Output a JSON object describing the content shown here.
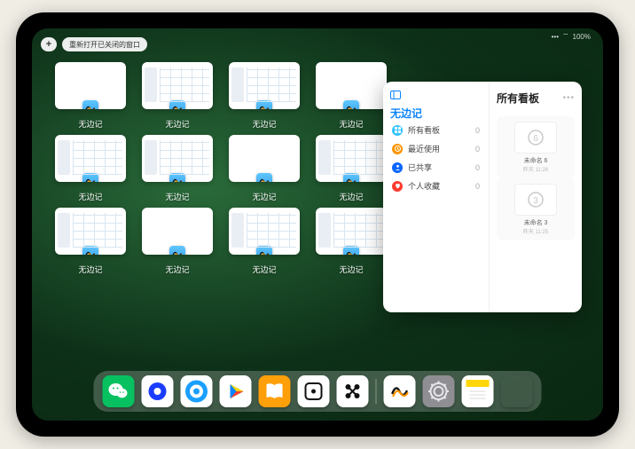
{
  "status": {
    "signal": "•••",
    "wifi": "⌔",
    "battery": "100%"
  },
  "top": {
    "add": "+",
    "reopen": "重新打开已关闭的窗口"
  },
  "app_label": "无边记",
  "windows": [
    {
      "type": "blank"
    },
    {
      "type": "calendar"
    },
    {
      "type": "calendar"
    },
    {
      "type": "blank"
    },
    {
      "type": "calendar"
    },
    {
      "type": "calendar"
    },
    {
      "type": "blank"
    },
    {
      "type": "calendar"
    },
    {
      "type": "calendar"
    },
    {
      "type": "blank"
    },
    {
      "type": "calendar"
    },
    {
      "type": "calendar"
    }
  ],
  "popover": {
    "left_title": "无边记",
    "right_title": "所有看板",
    "items": [
      {
        "icon": "grid",
        "color": "#34c3ff",
        "label": "所有看板",
        "count": 0
      },
      {
        "icon": "clock",
        "color": "#ff9500",
        "label": "最近使用",
        "count": 0
      },
      {
        "icon": "people",
        "color": "#0a66ff",
        "label": "已共享",
        "count": 0
      },
      {
        "icon": "heart",
        "color": "#ff3b30",
        "label": "个人收藏",
        "count": 0
      }
    ],
    "boards": [
      {
        "glyph": "6",
        "label": "未命名 6",
        "sub": "昨天 11:26"
      },
      {
        "glyph": "3",
        "label": "未命名 3",
        "sub": "昨天 11:25"
      }
    ]
  },
  "dock": [
    {
      "name": "wechat",
      "bg": "#07c160"
    },
    {
      "name": "browser1",
      "bg": "#ffffff"
    },
    {
      "name": "browser2",
      "bg": "#ffffff"
    },
    {
      "name": "play",
      "bg": "#ffffff"
    },
    {
      "name": "books",
      "bg": "#ff9f0a"
    },
    {
      "name": "dice",
      "bg": "#ffffff"
    },
    {
      "name": "connect",
      "bg": "#ffffff"
    },
    {
      "name": "sep"
    },
    {
      "name": "freeform",
      "bg": "#ffffff"
    },
    {
      "name": "settings",
      "bg": "#8e8e93"
    },
    {
      "name": "notes",
      "bg": "#ffffff"
    },
    {
      "name": "multi",
      "bg": "transparent"
    }
  ]
}
